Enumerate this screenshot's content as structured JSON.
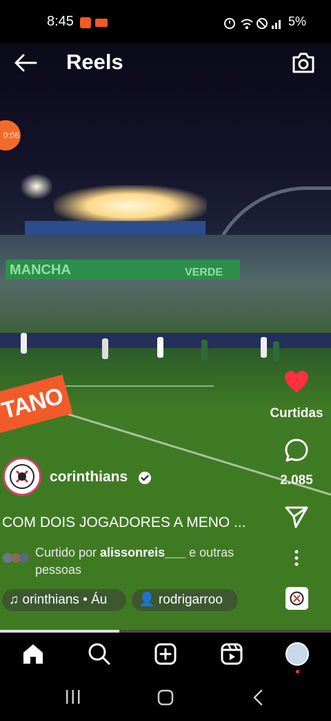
{
  "status_bar": {
    "time": "8:45",
    "battery": "5%"
  },
  "header": {
    "title": "Reels"
  },
  "video": {
    "board_text": "TANO",
    "timer": "0:06",
    "banner_text": "MANCHA",
    "banner_text2": "VERDE"
  },
  "actions": {
    "like_label": "Curtidas",
    "comment_count": "2.085",
    "like_color": "#ff3040"
  },
  "post": {
    "username": "corinthians",
    "caption": "COM DOIS JOGADORES A MENO ...",
    "liked_prefix": "Curtido por ",
    "liked_user": "alissonreis___",
    "liked_suffix": " e outras pessoas",
    "audio": "orinthians • Áu",
    "tagged": "rodrigarroo",
    "progress": 0.36
  },
  "nav": {
    "items": [
      "home-icon",
      "search-icon",
      "create-icon",
      "reels-icon",
      "profile-avatar"
    ]
  },
  "system_nav": {
    "items": [
      "recents-icon",
      "home-circle-icon",
      "back-chevron-icon"
    ]
  }
}
